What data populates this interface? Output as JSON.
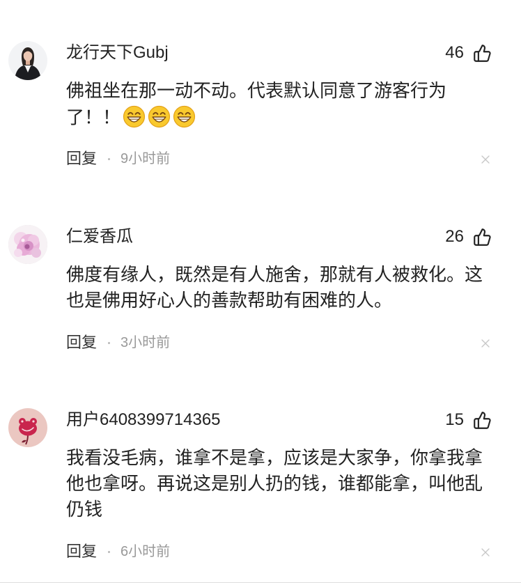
{
  "comments": [
    {
      "username": "龙行天下Gubj",
      "likes": "46",
      "lines": [
        "佛祖坐在那一动不动。代表默认同意了游客行为",
        "了！！"
      ],
      "emojis": [
        "grin-emoji",
        "grin-emoji",
        "grin-emoji"
      ],
      "reply_label": "回复",
      "time": "9小时前"
    },
    {
      "username": "仁爱香瓜",
      "likes": "26",
      "lines": [
        "佛度有缘人，既然是有人施舍，那就有人被救化。这",
        "也是佛用好心人的善款帮助有困难的人。"
      ],
      "reply_label": "回复",
      "time": "3小时前"
    },
    {
      "username": "用户6408399714365",
      "likes": "15",
      "lines": [
        "我看没毛病，谁拿不是拿，应该是大家争，你拿我拿",
        "他也拿呀。再说这是别人扔的钱，谁都能拿，叫他乱",
        "仍钱"
      ],
      "reply_label": "回复",
      "time": "6小时前"
    }
  ],
  "icons": {
    "like": "thumbs-up-icon",
    "dismiss": "close-icon"
  },
  "colors": {
    "text": "#222222",
    "secondary": "#999999",
    "reply": "#333333",
    "icon_light": "#c8c8c8",
    "emoji_yellow": "#f9c92e"
  }
}
